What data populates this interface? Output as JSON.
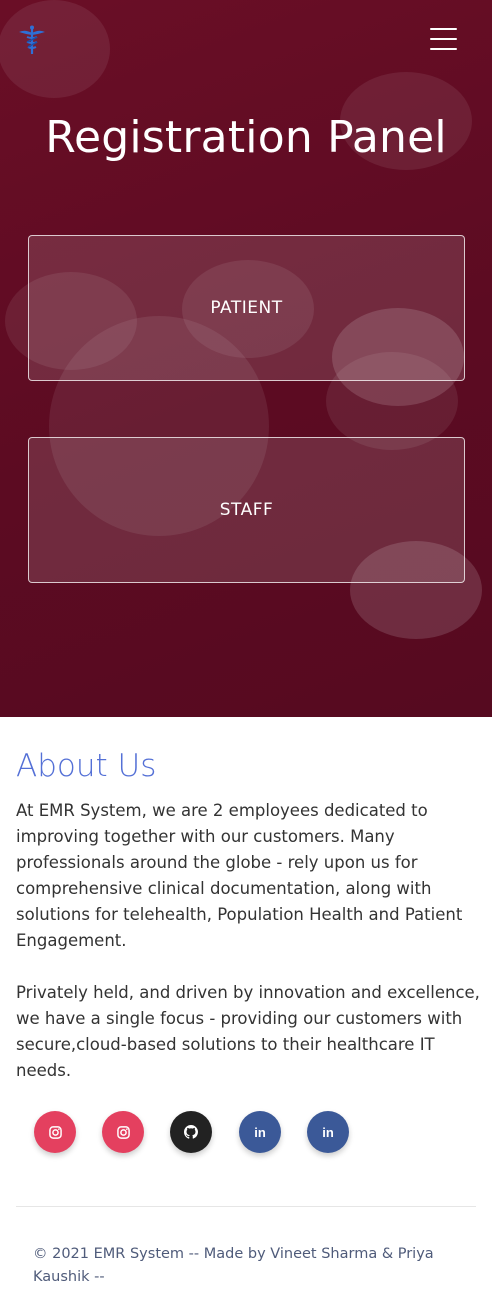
{
  "header": {
    "logo_icon": "caduceus-icon",
    "menu_icon": "hamburger-menu-icon"
  },
  "hero": {
    "title": "Registration Panel",
    "background": "#5c0b22",
    "buttons": {
      "patient": "PATIENT",
      "staff": "STAFF"
    }
  },
  "about": {
    "heading": "About Us",
    "heading_color": "#5470d6",
    "paragraph1": "At EMR System, we are 2 employees dedicated to improving together with our customers. Many professionals around the globe - rely upon us for comprehensive clinical documentation, along with solutions for telehealth, Population Health and Patient Engagement.",
    "paragraph2": "Privately held, and driven by innovation and excellence, we have a single focus - providing our customers with secure,cloud-based solutions to their healthcare IT needs."
  },
  "socials": [
    {
      "icon": "instagram-icon",
      "color": "#e4405f"
    },
    {
      "icon": "instagram-icon",
      "color": "#e4405f"
    },
    {
      "icon": "github-icon",
      "color": "#222222"
    },
    {
      "icon": "linkedin-icon",
      "color": "#3b5998"
    },
    {
      "icon": "linkedin-icon",
      "color": "#3b5998"
    }
  ],
  "footer": {
    "copyright": "© 2021 EMR System -- Made by Vineet Sharma & Priya Kaushik --"
  }
}
